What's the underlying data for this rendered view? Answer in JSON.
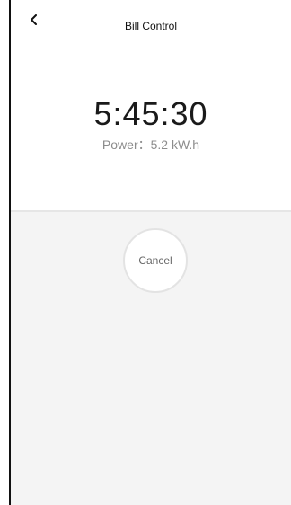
{
  "header": {
    "title": "Bill Control",
    "back_icon": "chevron-left-icon"
  },
  "session": {
    "elapsed_time": "5:45:30",
    "power_label": "Power：5.2 kW.h"
  },
  "actions": {
    "cancel_label": "Cancel"
  },
  "colors": {
    "background": "#ffffff",
    "lower_panel": "#f4f4f4",
    "timer_text": "#1a1a1a",
    "secondary_text": "#8c8c8c",
    "button_border": "#e3e3e3"
  }
}
